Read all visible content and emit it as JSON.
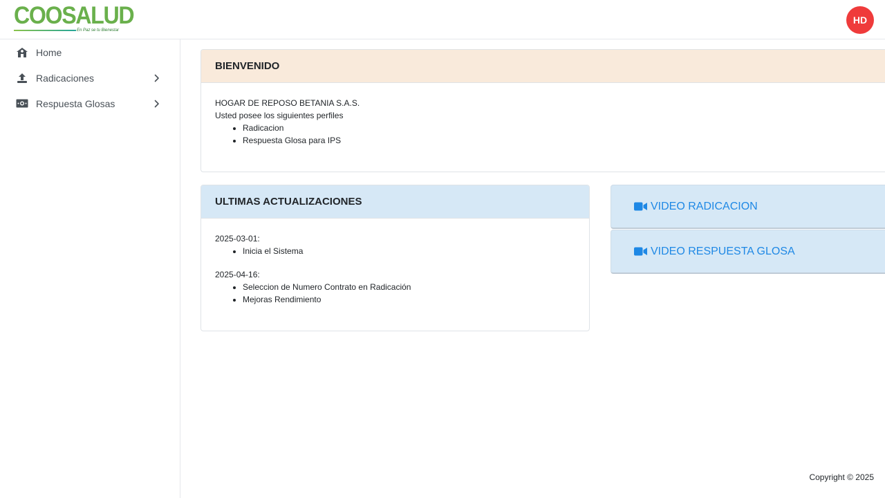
{
  "brand": {
    "logo_text": "COOSALUD",
    "tagline": "En Paz se tu Bienestar"
  },
  "user": {
    "initials": "HD",
    "avatar_color": "#ef3b3b"
  },
  "sidebar": {
    "items": [
      {
        "label": "Home",
        "icon": "home-icon",
        "has_submenu": false
      },
      {
        "label": "Radicaciones",
        "icon": "upload-icon",
        "has_submenu": true
      },
      {
        "label": "Respuesta Glosas",
        "icon": "money-bill-icon",
        "has_submenu": true
      }
    ]
  },
  "welcome": {
    "title": "BIENVENIDO",
    "entity": "HOGAR DE REPOSO BETANIA S.A.S.",
    "intro": "Usted posee los siguientes perfiles",
    "profiles": [
      "Radicacion",
      "Respuesta Glosa para IPS"
    ],
    "header_color": "#f9eadb"
  },
  "updates": {
    "title": "ULTIMAS ACTUALIZACIONES",
    "entries": [
      {
        "date": "2025-03-01:",
        "items": [
          "Inicia el Sistema"
        ]
      },
      {
        "date": "2025-04-16:",
        "items": [
          "Seleccion de Numero Contrato en Radicación",
          "Mejoras Rendimiento"
        ]
      }
    ],
    "header_color": "#d6e8f6"
  },
  "videos": [
    {
      "label": "VIDEO RADICACION",
      "icon": "video-camera-icon"
    },
    {
      "label": "VIDEO RESPUESTA GLOSA",
      "icon": "video-camera-icon"
    }
  ],
  "footer": {
    "copyright": "Copyright © 2025"
  },
  "colors": {
    "accent_blue": "#1e88e5",
    "brand_green": "#6ab04c"
  }
}
